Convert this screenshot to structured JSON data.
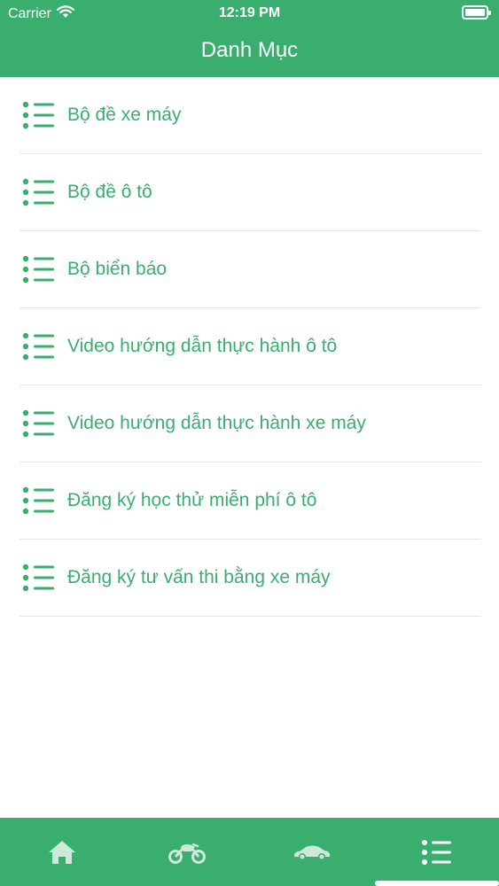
{
  "status_bar": {
    "carrier": "Carrier",
    "time": "12:19 PM"
  },
  "header": {
    "title": "Danh Mục"
  },
  "menu": {
    "items": [
      {
        "label": "Bộ đề xe máy"
      },
      {
        "label": "Bộ đề ô tô"
      },
      {
        "label": "Bộ biển báo"
      },
      {
        "label": "Video hướng dẫn thực hành ô tô"
      },
      {
        "label": "Video hướng dẫn thực hành xe máy"
      },
      {
        "label": "Đăng ký học thử miễn phí ô tô"
      },
      {
        "label": "Đăng ký tư vấn thi bằng xe máy"
      }
    ]
  },
  "tab_bar": {
    "tabs": [
      {
        "icon": "home-icon",
        "active": false
      },
      {
        "icon": "motorbike-icon",
        "active": false
      },
      {
        "icon": "car-icon",
        "active": false
      },
      {
        "icon": "list-icon",
        "active": true
      }
    ]
  },
  "colors": {
    "brand": "#3aae6f",
    "separator": "#e4e4e4",
    "inactive_tab_icon": "#cfe9d9"
  }
}
